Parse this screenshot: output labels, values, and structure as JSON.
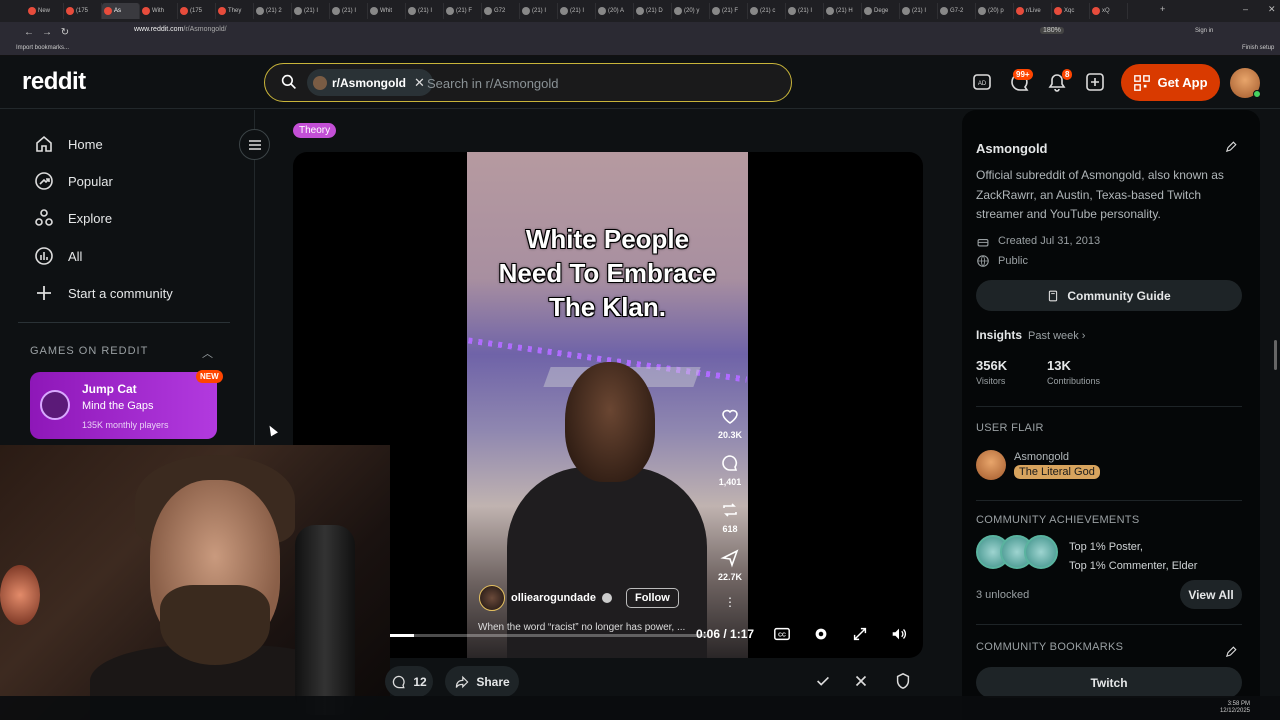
{
  "browser": {
    "tabs": [
      {
        "label": "New",
        "color": "#e74c3c"
      },
      {
        "label": "(175",
        "color": "#e74c3c"
      },
      {
        "label": "As",
        "color": "#e74c3c",
        "active": true
      },
      {
        "label": "With",
        "color": "#e74c3c"
      },
      {
        "label": "(175",
        "color": "#e74c3c"
      },
      {
        "label": "They",
        "color": "#e74c3c"
      },
      {
        "label": "(21) 2",
        "color": "#888"
      },
      {
        "label": "(21) I",
        "color": "#888"
      },
      {
        "label": "(21) I",
        "color": "#888"
      },
      {
        "label": "Whit",
        "color": "#888"
      },
      {
        "label": "(21) I",
        "color": "#888"
      },
      {
        "label": "(21) F",
        "color": "#888"
      },
      {
        "label": "G72",
        "color": "#888"
      },
      {
        "label": "(21) I",
        "color": "#888"
      },
      {
        "label": "(21) I",
        "color": "#888"
      },
      {
        "label": "(20) A",
        "color": "#888"
      },
      {
        "label": "(21) D",
        "color": "#888"
      },
      {
        "label": "(20) y",
        "color": "#888"
      },
      {
        "label": "(21) F",
        "color": "#888"
      },
      {
        "label": "(21) c",
        "color": "#888"
      },
      {
        "label": "(21) I",
        "color": "#888"
      },
      {
        "label": "(21) H",
        "color": "#888"
      },
      {
        "label": "Dege",
        "color": "#888"
      },
      {
        "label": "(21) I",
        "color": "#888"
      },
      {
        "label": "G7-2",
        "color": "#888"
      },
      {
        "label": "(20) p",
        "color": "#888"
      },
      {
        "label": "r/Live",
        "color": "#e74c3c"
      },
      {
        "label": "Xqc",
        "color": "#e74c3c"
      },
      {
        "label": "xQ",
        "color": "#e74c3c"
      }
    ],
    "url_host": "www.reddit.com",
    "url_path": "/r/Asmongold/",
    "zoom": "180%",
    "sign_in": "Sign in",
    "import_bookmarks": "Import bookmarks...",
    "finish_setup": "Finish setup"
  },
  "header": {
    "logo": "reddit",
    "search_chip": "r/Asmongold",
    "search_placeholder": "Search in r/Asmongold",
    "chat_badge": "99+",
    "notif_badge": "8",
    "get_app": "Get App"
  },
  "leftnav": {
    "items": [
      {
        "label": "Home",
        "icon": "home-icon"
      },
      {
        "label": "Popular",
        "icon": "popular-icon"
      },
      {
        "label": "Explore",
        "icon": "explore-icon"
      },
      {
        "label": "All",
        "icon": "all-icon"
      },
      {
        "label": "Start a community",
        "icon": "plus-icon"
      }
    ],
    "games_heading": "GAMES ON REDDIT",
    "game": {
      "title": "Jump Cat",
      "subtitle": "Mind the Gaps",
      "players": "135K monthly players",
      "badge": "NEW"
    }
  },
  "post": {
    "flair": "Theory",
    "caption_lines": [
      "White People",
      "Need To Embrace",
      "The Klan."
    ],
    "likes": "20.3K",
    "comments": "1,401",
    "reposts": "618",
    "shares": "22.7K",
    "username": "olliearogundade",
    "follow_label": "Follow",
    "description": "When the word “racist” no longer has power, ...",
    "time": "0:06 / 1:17",
    "progress": 0.077,
    "comment_count": "12",
    "share_label": "Share"
  },
  "sidebar": {
    "name": "Asmongold",
    "description": "Official subreddit of Asmongold, also known as ZackRawrr, an Austin, Texas-based Twitch streamer and YouTube personality.",
    "created": "Created Jul 31, 2013",
    "visibility": "Public",
    "guide_label": "Community Guide",
    "insights_label": "Insights",
    "insights_period": "Past week",
    "visitors_value": "356K",
    "visitors_label": "Visitors",
    "contrib_value": "13K",
    "contrib_label": "Contributions",
    "user_flair_heading": "USER FLAIR",
    "flair_name": "Asmongold",
    "flair_tag": "The Literal God",
    "achievements_heading": "COMMUNITY ACHIEVEMENTS",
    "achievement_1": "Top 1% Poster,",
    "achievement_2": "Top 1% Commenter, Elder",
    "unlocked": "3 unlocked",
    "view_all": "View All",
    "bookmarks_heading": "COMMUNITY BOOKMARKS",
    "bookmark_1": "Twitch"
  },
  "taskbar": {
    "time": "3:58 PM",
    "date": "12/12/2025"
  },
  "colors": {
    "accent": "#ff4500",
    "get_app_bg": "#d93a00",
    "flair": "#c34fd6",
    "game_card": "#a429d3"
  }
}
